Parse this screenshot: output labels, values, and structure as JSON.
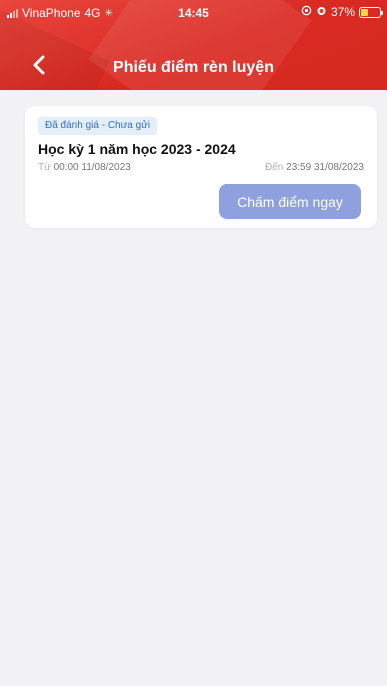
{
  "status_bar": {
    "carrier": "VinaPhone",
    "network": "4G",
    "time": "14:45",
    "battery": "37%",
    "battery_level": 0.37
  },
  "header": {
    "title": "Phiếu điểm rèn luyện",
    "back_icon": "chevron-left-icon"
  },
  "card": {
    "status_badge": "Đã đánh giá - Chưa gửi",
    "title": "Học kỳ 1 năm học 2023 - 2024",
    "from_prefix": "Từ",
    "from_date": "00:00 11/08/2023",
    "to_prefix": "Đến",
    "to_date": "23:59 31/08/2023",
    "action_label": "Chấm điểm ngay"
  },
  "colors": {
    "header": "#d92a22",
    "badge_bg": "#e5eefb",
    "badge_text": "#2e6fd8",
    "button": "#8ea1de",
    "background": "#f2f2f4"
  }
}
